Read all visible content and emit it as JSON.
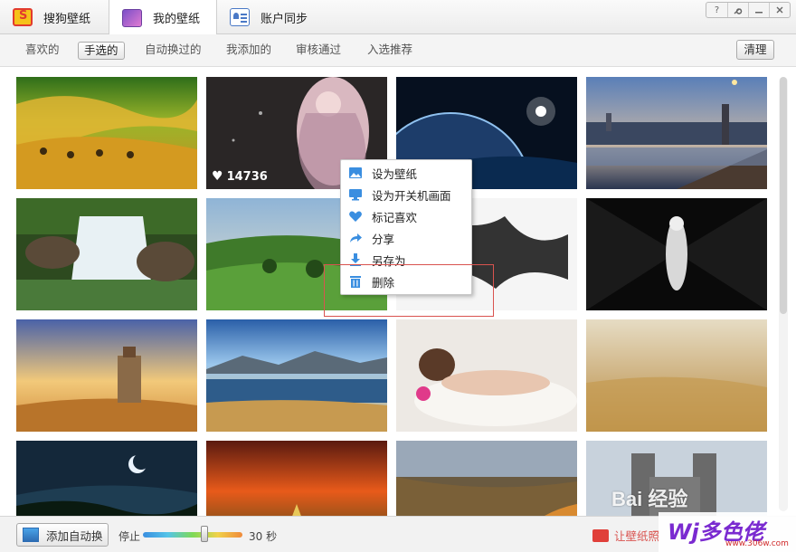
{
  "tabs": [
    {
      "label": "搜狗壁纸",
      "icon": "sogou-logo-icon"
    },
    {
      "label": "我的壁纸",
      "icon": "my-wallpaper-icon",
      "active": true
    },
    {
      "label": "账户同步",
      "icon": "account-sync-icon"
    }
  ],
  "window_buttons": [
    "?",
    "skin",
    "minimize",
    "close"
  ],
  "subnav": [
    {
      "label": "喜欢的"
    },
    {
      "label": "手选的",
      "active": true
    },
    {
      "label": "自动换过的"
    },
    {
      "label": "我添加的"
    },
    {
      "label": "审核通过"
    },
    {
      "label": "入选推荐"
    }
  ],
  "clean_button": "清理",
  "thumbnails": [
    {
      "subject": "golden rolling hills"
    },
    {
      "subject": "anime girl illustration",
      "likes": "14736"
    },
    {
      "subject": "planet in space"
    },
    {
      "subject": "city river at dusk"
    },
    {
      "subject": "forest waterfall"
    },
    {
      "subject": "green valley"
    },
    {
      "subject": "black and white sketch"
    },
    {
      "subject": "black star idol"
    },
    {
      "subject": "lighthouse desert"
    },
    {
      "subject": "mountain lake"
    },
    {
      "subject": "girl lying on bed"
    },
    {
      "subject": "wheat field"
    },
    {
      "subject": "crescent moon"
    },
    {
      "subject": "sunset sky road"
    },
    {
      "subject": "canyon autumn"
    },
    {
      "subject": "stone castle"
    }
  ],
  "context_menu": [
    {
      "label": "设为壁纸",
      "icon": "image-icon"
    },
    {
      "label": "设为开关机画面",
      "icon": "monitor-icon"
    },
    {
      "label": "标记喜欢",
      "icon": "heart-icon"
    },
    {
      "label": "分享",
      "icon": "share-arrow-icon"
    },
    {
      "label": "另存为",
      "icon": "download-icon"
    },
    {
      "label": "删除",
      "icon": "trash-icon"
    }
  ],
  "bottom": {
    "auto_button": "添加自动换",
    "stop_label": "停止",
    "interval_label": "30 秒",
    "promo_text": "让壁纸照"
  },
  "watermarks": {
    "baidu": "Bai 经验",
    "site": "Wj多色佬",
    "site_url": "www.306w.com"
  },
  "colors": {
    "accent_red": "#d9534f",
    "menu_icon_blue": "#3a8ee0"
  }
}
